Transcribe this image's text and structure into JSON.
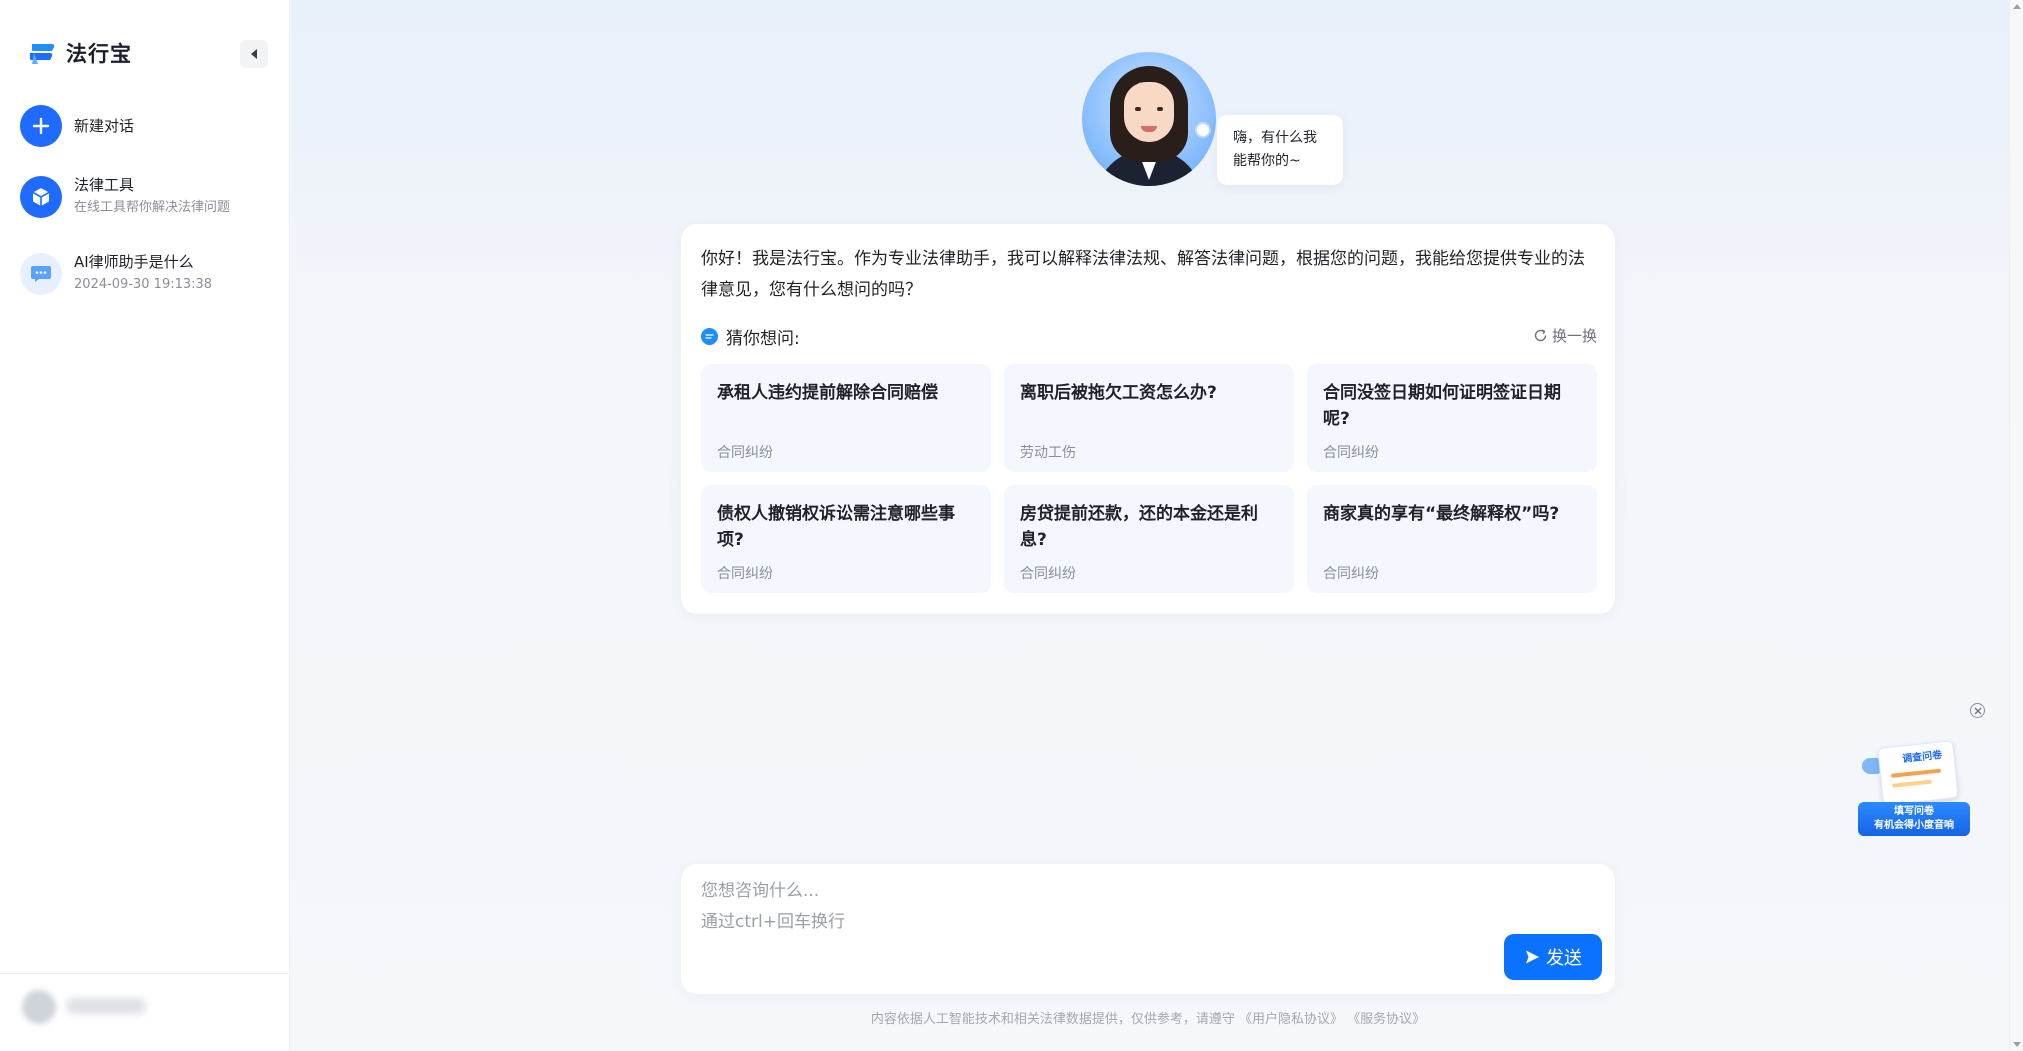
{
  "brand": {
    "name": "法行宝"
  },
  "sidebar": {
    "new_chat": {
      "label": "新建对话"
    },
    "tools": {
      "title": "法律工具",
      "subtitle": "在线工具帮你解决法律问题"
    },
    "history": [
      {
        "title": "AI律师助手是什么",
        "time": "2024-09-30 19:13:38"
      }
    ]
  },
  "assistant": {
    "greeting": "嗨，有什么我能帮你的~",
    "intro": "你好！我是法行宝。作为专业法律助手，我可以解释法律法规、解答法律问题，根据您的问题，我能给您提供专业的法律意见，您有什么想问的吗？"
  },
  "suggestions": {
    "heading": "猜你想问:",
    "refresh_label": "换一换",
    "items": [
      {
        "title": "承租人违约提前解除合同赔偿",
        "tag": "合同纠纷"
      },
      {
        "title": "离职后被拖欠工资怎么办?",
        "tag": "劳动工伤"
      },
      {
        "title": "合同没签日期如何证明签证日期呢?",
        "tag": "合同纠纷"
      },
      {
        "title": "债权人撤销权诉讼需注意哪些事项?",
        "tag": "合同纠纷"
      },
      {
        "title": "房贷提前还款，还的本金还是利息?",
        "tag": "合同纠纷"
      },
      {
        "title": "商家真的享有“最终解释权”吗?",
        "tag": "合同纠纷"
      }
    ]
  },
  "survey": {
    "title": "调查问卷",
    "line1": "填写问卷",
    "line2": "有机会得小度音响"
  },
  "composer": {
    "placeholder": "您想咨询什么...\n通过ctrl+回车换行",
    "value": "",
    "send_label": "发送"
  },
  "footer": {
    "text": "内容依据人工智能技术和相关法律数据提供，仅供参考，请遵守",
    "link_privacy": "《用户隐私协议》",
    "link_service": "《服务协议》"
  },
  "colors": {
    "accent": "#1f6bff",
    "send": "#0a72ff",
    "card_bg": "#f4f7fd"
  },
  "icons": {
    "logo": "fa-xing-bao-logo",
    "collapse": "caret-left-icon",
    "new_chat": "plus-icon",
    "tools": "cube-icon",
    "history": "chat-bubble-icon",
    "guess": "chat-icon",
    "refresh": "refresh-icon",
    "send": "send-icon",
    "close": "close-icon"
  }
}
